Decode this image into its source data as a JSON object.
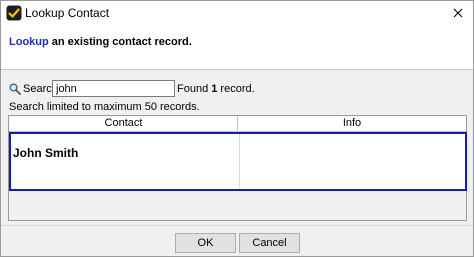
{
  "window": {
    "title": "Lookup Contact"
  },
  "banner": {
    "accent_word": "Lookup",
    "rest": " an existing contact record."
  },
  "search": {
    "label": "Search:",
    "value": "john",
    "found_prefix": "Found ",
    "found_count": "1",
    "found_suffix": " record.",
    "limit_note": "Search limited to maximum 50 records."
  },
  "table": {
    "columns": [
      "Contact",
      "Info"
    ],
    "rows": [
      {
        "contact": "John Smith",
        "info": ""
      }
    ]
  },
  "buttons": {
    "ok": "OK",
    "cancel": "Cancel"
  },
  "colors": {
    "accent": "#1b2fb5",
    "selection_border": "#1a1aa8"
  }
}
